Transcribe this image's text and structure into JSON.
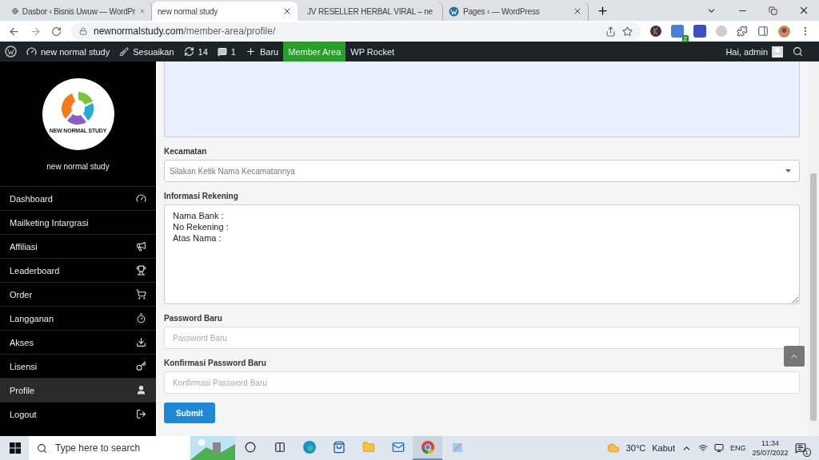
{
  "browser": {
    "tabs": [
      {
        "title": "Dasbor ‹ Bisnis Uwuw — WordPr",
        "selected": false
      },
      {
        "title": "new normal study",
        "selected": true
      },
      {
        "title": "JV RESELLER HERBAL VIRAL – ne",
        "selected": false
      },
      {
        "title": "Pages ‹ — WordPress",
        "selected": false
      }
    ],
    "url_host": "newnormalstudy.com",
    "url_path": "/member-area/profile/",
    "extension_badge": "2"
  },
  "admin_bar": {
    "items": [
      {
        "kind": "site",
        "label": "new normal study",
        "highlighted": false
      },
      {
        "kind": "customize",
        "label": "Sesuaikan",
        "highlighted": false
      },
      {
        "kind": "updates",
        "label": "14",
        "highlighted": false
      },
      {
        "kind": "comments",
        "label": "1",
        "highlighted": false
      },
      {
        "kind": "new",
        "label": "Baru",
        "highlighted": false
      },
      {
        "kind": "text",
        "label": "Member Area",
        "highlighted": true
      },
      {
        "kind": "text",
        "label": "WP Rocket",
        "highlighted": false
      }
    ],
    "greeting": "Hai, admin"
  },
  "sidebar": {
    "logo_text": "NEW NORMAL STUDY",
    "site_name": "new normal study",
    "items": [
      {
        "label": "Dashboard",
        "selected": false
      },
      {
        "label": "Mailketing Intargrasi",
        "selected": false
      },
      {
        "label": "Affiliasi",
        "selected": false
      },
      {
        "label": "Leaderboard",
        "selected": false
      },
      {
        "label": "Order",
        "selected": false
      },
      {
        "label": "Langganan",
        "selected": false
      },
      {
        "label": "Akses",
        "selected": false
      },
      {
        "label": "Lisensi",
        "selected": false
      },
      {
        "label": "Profile",
        "selected": true
      },
      {
        "label": "Logout",
        "selected": false
      }
    ]
  },
  "form": {
    "fields": [
      {
        "kind": "select",
        "label": "Kecamatan",
        "placeholder": "Silakan Ketik Nama Kecamatannya"
      },
      {
        "kind": "textarea",
        "label": "Informasi Rekening",
        "value": "Nama Bank :\nNo Rekening :\nAtas Nama :"
      },
      {
        "kind": "input",
        "label": "Password Baru",
        "placeholder": "Password Baru"
      },
      {
        "kind": "input",
        "label": "Konfirmasi Password Baru",
        "placeholder": "Konfirmasi Password Baru"
      }
    ],
    "submit": "Submit"
  },
  "taskbar": {
    "search_placeholder": "Type here to search",
    "temperature": "30°C",
    "weather": "Kabut",
    "language": "ENG",
    "time": "11:34",
    "date": "25/07/2022",
    "notifications": "1"
  }
}
